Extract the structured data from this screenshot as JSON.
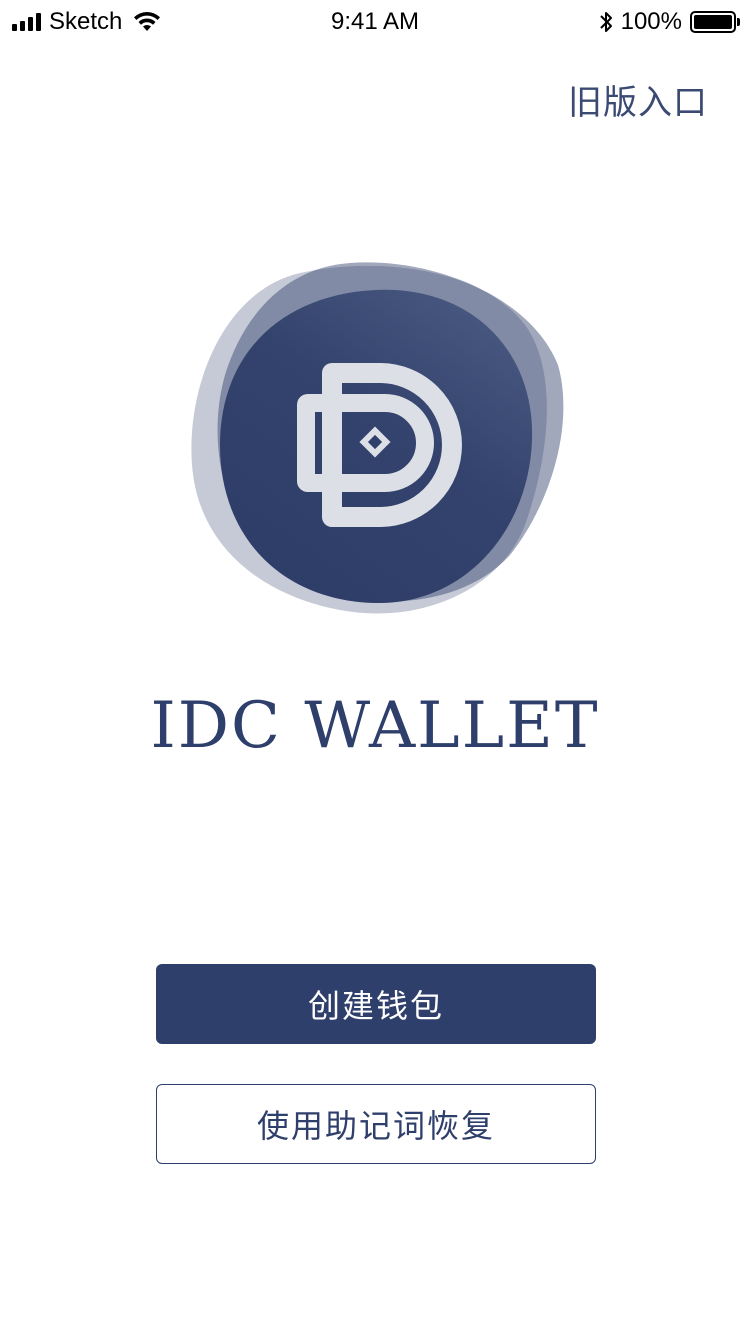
{
  "status_bar": {
    "carrier": "Sketch",
    "time": "9:41 AM",
    "battery_percent": "100%",
    "battery_level": 1.0,
    "icons": [
      "signal-icon",
      "wifi-icon",
      "bluetooth-icon",
      "battery-icon"
    ]
  },
  "header": {
    "old_version_link": "旧版入口"
  },
  "brand": {
    "app_name": "IDC WALLET",
    "logo": "idc-wallet-logo",
    "accent_color": "#2f3f6b"
  },
  "actions": {
    "create_wallet": "创建钱包",
    "restore_mnemonic": "使用助记词恢复"
  }
}
